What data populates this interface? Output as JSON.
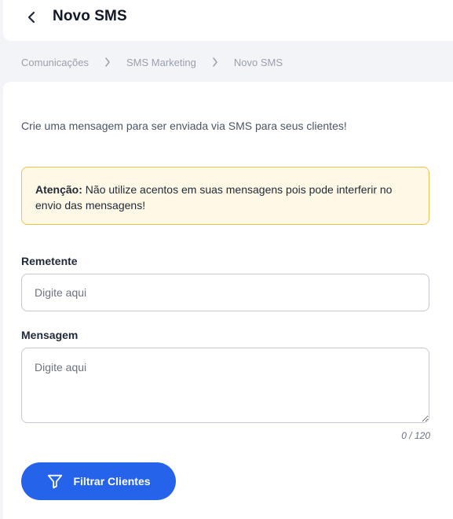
{
  "header": {
    "title": "Novo SMS",
    "back_icon": "chevron-left-icon"
  },
  "breadcrumb": {
    "items": [
      "Comunicações",
      "SMS Marketing",
      "Novo SMS"
    ],
    "separator_icon": "chevron-right-icon"
  },
  "intro": "Crie uma mensagem para ser enviada via SMS para seus clientes!",
  "alert": {
    "title": "Atenção:",
    "message": " Não utilize acentos em suas mensagens pois pode interferir no envio das mensagens!"
  },
  "form": {
    "sender": {
      "label": "Remetente",
      "placeholder": "Digite aqui",
      "value": ""
    },
    "message": {
      "label": "Mensagem",
      "placeholder": "Digite aqui",
      "value": "",
      "counter": "0 / 120"
    }
  },
  "actions": {
    "filter_label": "Filtrar Clientes",
    "filter_icon": "filter-icon"
  },
  "colors": {
    "primary": "#2563eb",
    "alert_bg": "#fff8e6",
    "alert_border": "#f1c24a",
    "page_bg": "#f3f4f7"
  }
}
